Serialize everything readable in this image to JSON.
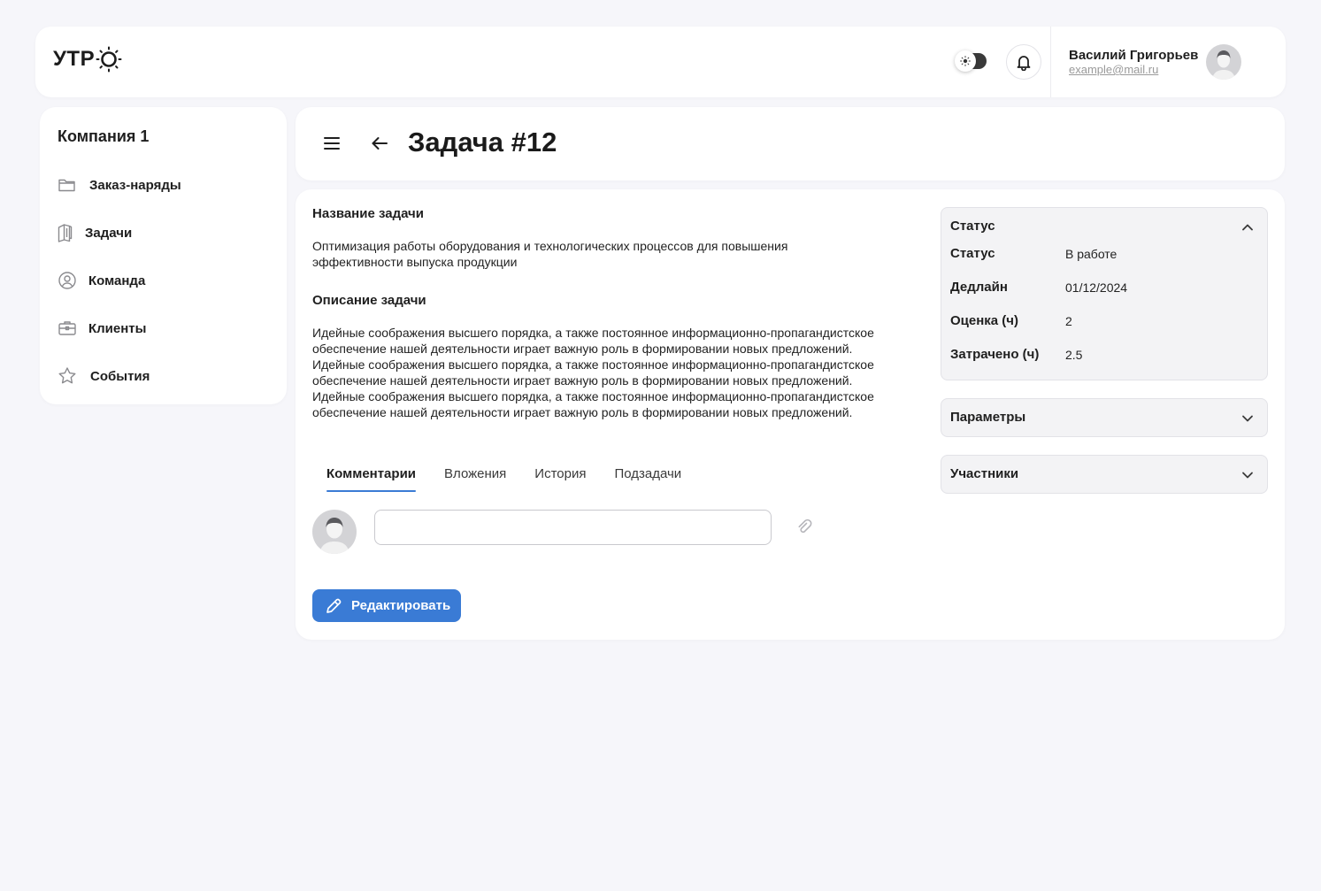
{
  "header": {
    "logo_text": "УТР",
    "user_name": "Василий Григорьев",
    "user_email": "example@mail.ru",
    "accent_color": "#3a7bd5"
  },
  "sidebar": {
    "company": "Компания 1",
    "items": [
      {
        "label": "Заказ-наряды",
        "icon": "folder-icon"
      },
      {
        "label": "Задачи",
        "icon": "tasks-icon"
      },
      {
        "label": "Команда",
        "icon": "user-circle-icon"
      },
      {
        "label": "Клиенты",
        "icon": "briefcase-icon"
      },
      {
        "label": "События",
        "icon": "star-icon"
      }
    ]
  },
  "page": {
    "title": "Задача #12"
  },
  "task": {
    "name_heading": "Название задачи",
    "name": "Оптимизация работы оборудования и технологических процессов для повышения эффективности выпуска продукции",
    "description_heading": "Описание задачи",
    "description": "Идейные соображения высшего порядка, а также постоянное информационно-пропагандистское обеспечение нашей деятельности играет важную роль в формировании новых предложений. Идейные соображения высшего порядка, а также постоянное информационно-пропагандистское обеспечение нашей деятельности играет важную роль в формировании новых предложений. Идейные соображения высшего порядка, а также постоянное информационно-пропагандистское обеспечение нашей деятельности играет важную роль в формировании новых предложений."
  },
  "tabs": [
    {
      "label": "Комментарии",
      "active": true
    },
    {
      "label": "Вложения",
      "active": false
    },
    {
      "label": "История",
      "active": false
    },
    {
      "label": "Подзадачи",
      "active": false
    }
  ],
  "comment": {
    "value": "",
    "placeholder": ""
  },
  "actions": {
    "edit_label": "Редактировать"
  },
  "status_panel": {
    "title": "Статус",
    "expanded": true,
    "rows": [
      {
        "key": "Статус",
        "value": "В работе"
      },
      {
        "key": "Дедлайн",
        "value": "01/12/2024"
      },
      {
        "key": "Оценка (ч)",
        "value": "2"
      },
      {
        "key": "Затрачено (ч)",
        "value": "2.5"
      }
    ]
  },
  "params_panel": {
    "title": "Параметры",
    "expanded": false
  },
  "participants_panel": {
    "title": "Участники",
    "expanded": false
  }
}
